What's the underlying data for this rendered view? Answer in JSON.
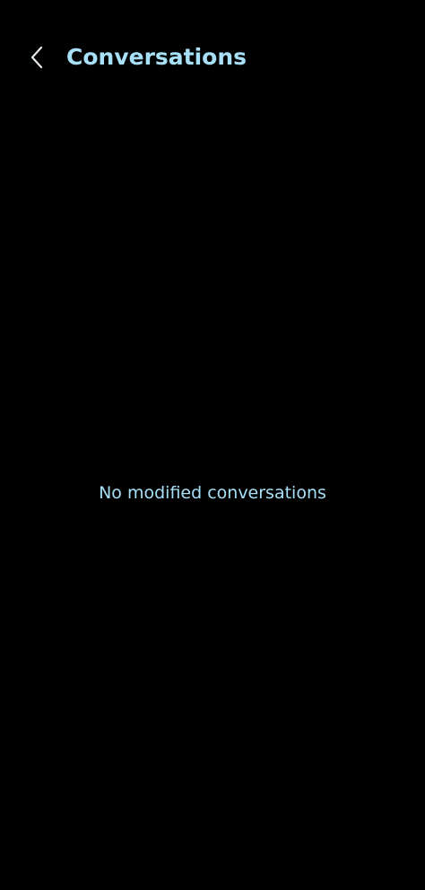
{
  "header": {
    "back_icon": "chevron-left-icon",
    "title": "Conversations"
  },
  "main": {
    "empty_message": "No modified conversations"
  },
  "colors": {
    "background": "#000000",
    "accent_text": "#a7e0f7"
  }
}
